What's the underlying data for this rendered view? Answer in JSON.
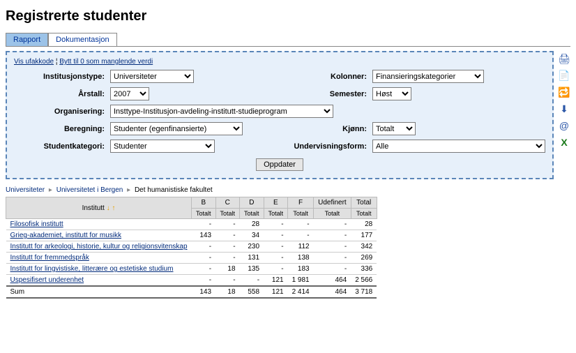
{
  "title": "Registrerte studenter",
  "tabs": [
    {
      "label": "Rapport",
      "active": true
    },
    {
      "label": "Dokumentasjon",
      "active": false
    }
  ],
  "toplinks": {
    "link1": "Vis ufakkode",
    "sep": " ¦ ",
    "link2": "Bytt til 0 som manglende verdi"
  },
  "filters": {
    "institusjonstype": {
      "label": "Institusjonstype:",
      "value": "Universiteter"
    },
    "kolonner": {
      "label": "Kolonner:",
      "value": "Finansieringskategorier"
    },
    "arstall": {
      "label": "Årstall:",
      "value": "2007"
    },
    "semester": {
      "label": "Semester:",
      "value": "Høst"
    },
    "organisering": {
      "label": "Organisering:",
      "value": "Insttype-Institusjon-avdeling-institutt-studieprogram"
    },
    "beregning": {
      "label": "Beregning:",
      "value": "Studenter (egenfinansierte)"
    },
    "kjonn": {
      "label": "Kjønn:",
      "value": "Totalt"
    },
    "studentkategori": {
      "label": "Studentkategori:",
      "value": "Studenter"
    },
    "undervisningsform": {
      "label": "Undervisningsform:",
      "value": "Alle"
    }
  },
  "update_label": "Oppdater",
  "breadcrumb": [
    "Universiteter",
    "Universitetet i Bergen",
    "Det humanistiske fakultet"
  ],
  "table": {
    "institutt_header": "Institutt",
    "columns": [
      "B",
      "C",
      "D",
      "E",
      "F",
      "Udefinert",
      "Total"
    ],
    "subheader": "Totalt",
    "rows": [
      {
        "name": "Filosofisk institutt",
        "vals": [
          "-",
          "-",
          "28",
          "-",
          "-",
          "-",
          "28"
        ]
      },
      {
        "name": "Grieg-akademiet, institutt for musikk",
        "vals": [
          "143",
          "-",
          "34",
          "-",
          "-",
          "-",
          "177"
        ]
      },
      {
        "name": "Institutt for arkeologi, historie, kultur og religionsvitenskap",
        "vals": [
          "-",
          "-",
          "230",
          "-",
          "112",
          "-",
          "342"
        ]
      },
      {
        "name": "Institutt for fremmedspråk",
        "vals": [
          "-",
          "-",
          "131",
          "-",
          "138",
          "-",
          "269"
        ]
      },
      {
        "name": "Institutt for lingvistiske, litterære og estetiske studium",
        "vals": [
          "-",
          "18",
          "135",
          "-",
          "183",
          "-",
          "336"
        ]
      },
      {
        "name": "Uspesifisert underenhet",
        "vals": [
          "-",
          "-",
          "-",
          "121",
          "1 981",
          "464",
          "2 566"
        ]
      }
    ],
    "sum": {
      "label": "Sum",
      "vals": [
        "143",
        "18",
        "558",
        "121",
        "2 414",
        "464",
        "3 718"
      ]
    }
  },
  "icons": {
    "print": "🖨",
    "copy": "📄",
    "exchange": "🔁",
    "download": "⬇",
    "mail": "@",
    "excel": "X"
  }
}
